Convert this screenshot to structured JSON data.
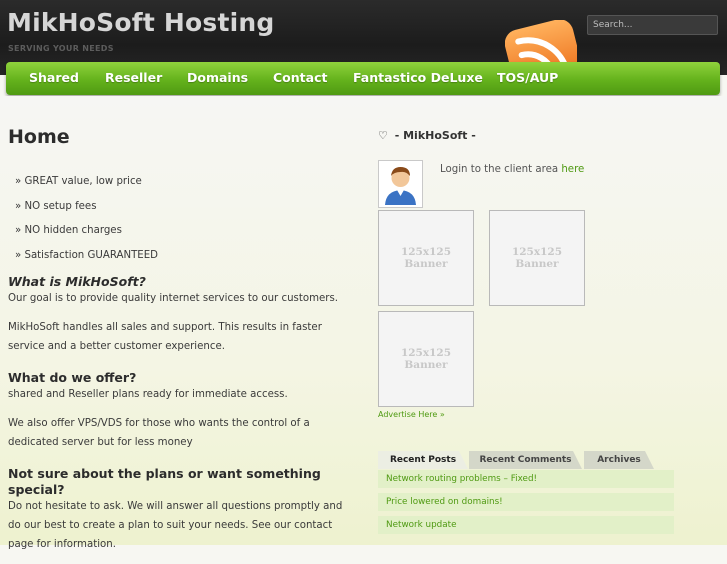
{
  "header": {
    "site_title": "MikHoSoft Hosting",
    "tagline": "SERVING YOUR NEEDS",
    "search_placeholder": "Search..."
  },
  "nav": {
    "items": [
      {
        "label": "Shared"
      },
      {
        "label": "Reseller"
      },
      {
        "label": "Domains"
      },
      {
        "label": "Contact"
      },
      {
        "label": "Fantastico DeLuxe"
      },
      {
        "label": "TOS/AUP"
      }
    ]
  },
  "main": {
    "title": "Home",
    "bullets": [
      "» GREAT value, low price",
      "» NO setup fees",
      "» NO hidden charges",
      "» Satisfaction GUARANTEED"
    ],
    "sections": [
      {
        "heading": "What is MikHoSoft?",
        "paragraphs": [
          "Our goal is to provide quality internet services to our customers.",
          "MikHoSoft handles all sales and support. This results in faster service and a better customer experience."
        ]
      },
      {
        "heading": "What do we offer?",
        "paragraphs": [
          "shared and Reseller plans ready for immediate access.",
          "We also offer VPS/VDS for those who wants the control of a dedicated server but for less money"
        ]
      },
      {
        "heading": "Not sure about the plans or want something special?",
        "paragraphs": [
          "Do not hesitate to ask. We will answer all questions promptly and do our best to create a plan to suit your needs. See our contact page for information."
        ]
      }
    ]
  },
  "sidebar": {
    "widget_title": "- MikHoSoft -",
    "heart_glyph": "♡",
    "login_text": "Login to the client area",
    "login_link": "here",
    "banner_text": [
      "125x125",
      "Banner"
    ],
    "advertise": "Advertise Here »",
    "tabs": [
      "Recent Posts",
      "Recent Comments",
      "Archives"
    ],
    "posts": [
      "Network routing problems – Fixed!",
      "Price lowered on domains!",
      "Network update"
    ]
  },
  "colors": {
    "accent": "#64b21c",
    "link": "#4f9a12",
    "header_bg": "#262626"
  },
  "icons": [
    "rss-icon",
    "heart-icon",
    "user-avatar-icon"
  ]
}
